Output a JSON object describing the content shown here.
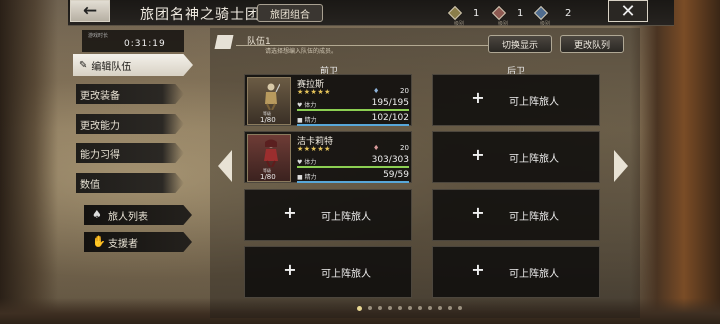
{
  "header": {
    "back_icon": "left-arrow-icon",
    "title": "旅团名神之骑士团",
    "combo_tab": "旅团组合",
    "resources": [
      {
        "icon": "badge-gold-icon",
        "label": "级别",
        "value": "1",
        "color": "#cbbd7a"
      },
      {
        "icon": "badge-red-icon",
        "label": "级别",
        "value": "1",
        "color": "#c9a49a"
      },
      {
        "icon": "badge-blue-icon",
        "label": "级别",
        "value": "2",
        "color": "#8fb1d8"
      }
    ],
    "close_icon": "close-icon"
  },
  "sidebar": {
    "timer_label": "游戏时长",
    "timer_value": "0:31:19",
    "menu": [
      {
        "label": "编辑队伍",
        "active": true,
        "icon": "pen-icon"
      },
      {
        "label": "更改装备",
        "active": false
      },
      {
        "label": "更改能力",
        "active": false
      },
      {
        "label": "能力习得",
        "active": false
      },
      {
        "label": "数值",
        "active": false
      }
    ],
    "buttons": [
      {
        "label": "旅人列表",
        "icon": "travelers-icon"
      },
      {
        "label": "支援者",
        "icon": "handshake-icon"
      }
    ]
  },
  "team": {
    "name": "队伍1",
    "hint": "请选择想编入队伍的成员。",
    "switch_display": "切换显示",
    "change_team": "更改队列",
    "front_label": "前卫",
    "back_label": "后卫",
    "empty_label": "可上阵旅人",
    "front": [
      {
        "name": "赛拉斯",
        "stars": "★★★★★",
        "lv_tag": "等级",
        "lv": "1/80",
        "bond": "20",
        "hp_label": "体力",
        "hp": "195/195",
        "hp_ratio": 1.0,
        "sp_label": "精力",
        "sp": "102/102",
        "sp_ratio": 1.0
      },
      {
        "name": "洁卡莉特",
        "stars": "★★★★★",
        "lv_tag": "等级",
        "lv": "1/80",
        "bond": "20",
        "hp_label": "体力",
        "hp": "303/303",
        "hp_ratio": 1.0,
        "sp_label": "精力",
        "sp": "59/59",
        "sp_ratio": 1.0
      }
    ]
  },
  "pager": {
    "total": 11,
    "active_index": 0
  },
  "colors": {
    "hp": "#8ccf52",
    "sp": "#58a7d8",
    "star": "#e6c45a"
  }
}
